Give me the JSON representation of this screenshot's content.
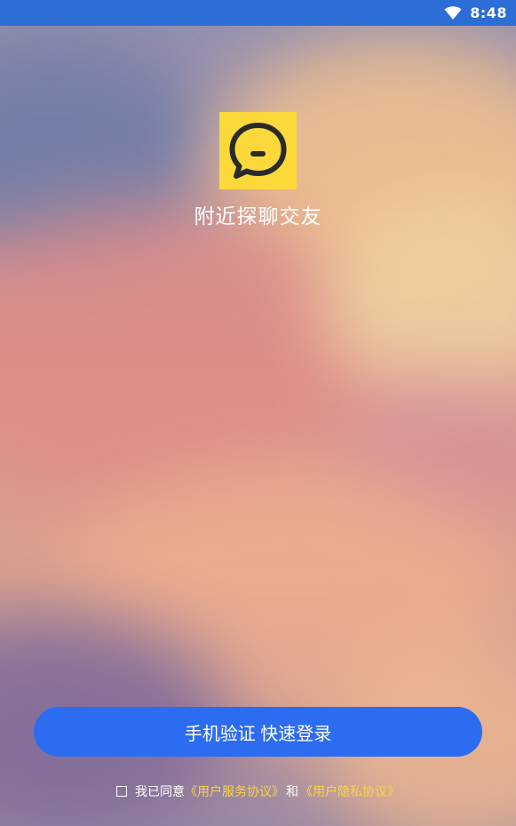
{
  "status_bar": {
    "time": "8:48",
    "wifi_icon": "wifi-icon",
    "background_color": "#2c6ed6"
  },
  "app": {
    "logo_icon": "chat-bubble-icon",
    "logo_color": "#fbd93a",
    "name": "附近探聊交友"
  },
  "login": {
    "button_label": "手机验证 快速登录",
    "button_color": "#2c6cf1"
  },
  "agreement": {
    "checkbox_checked": false,
    "prefix": "我已同意",
    "service_link": "《用户服务协议》",
    "conjunction": "和",
    "privacy_link": "《用户隐私协议》",
    "link_color": "#f7d44a"
  }
}
